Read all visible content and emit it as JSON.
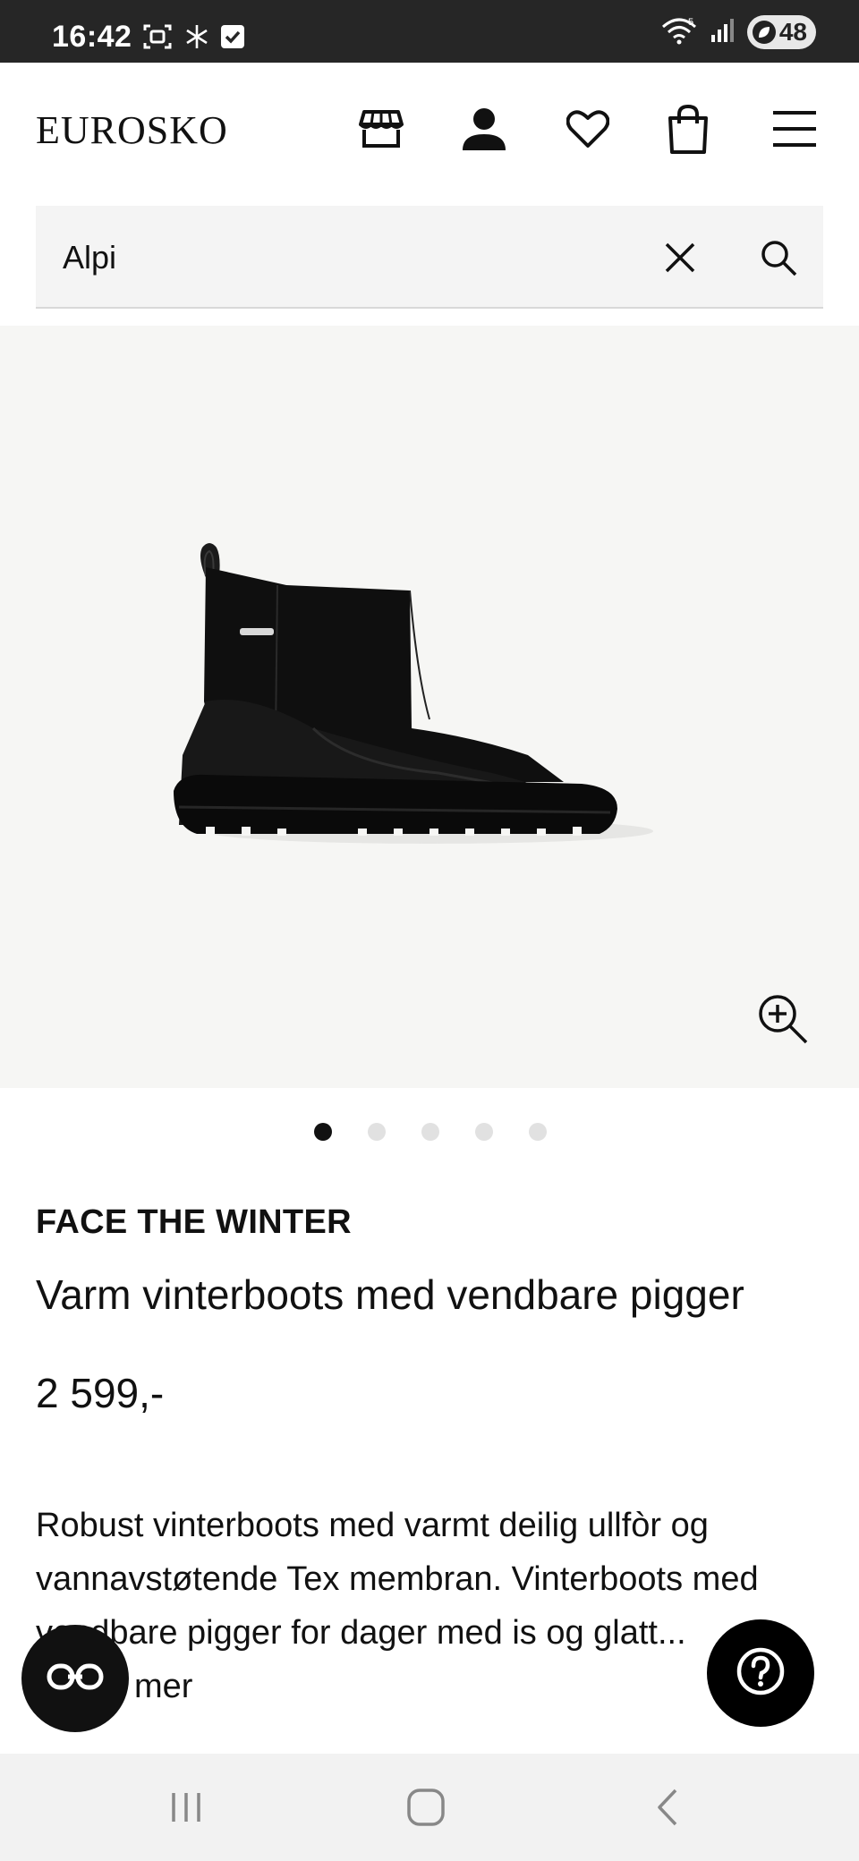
{
  "status_bar": {
    "time": "16:42",
    "icons": [
      "screenshot-icon",
      "snowflake-icon",
      "checkbox-icon"
    ],
    "network": "5",
    "battery": "48"
  },
  "header": {
    "logo": "EUROSKO",
    "icons": [
      "store-icon",
      "account-icon",
      "wishlist-heart-icon",
      "cart-bag-icon",
      "menu-icon"
    ]
  },
  "search": {
    "value": "Alpi",
    "clear_icon": "close-icon",
    "search_icon": "search-icon"
  },
  "gallery": {
    "image": "black winter boot",
    "zoom_icon": "zoom-in-icon",
    "slide_count": 5,
    "active_slide": 1
  },
  "product": {
    "brand": "FACE THE WINTER",
    "title": "Varm vinterboots med vendbare pigger",
    "price": "2 599,-",
    "description": "Robust vinterboots med varmt deilig ullfòr og vannavstøtende Tex membran. Vinterboots med vendbare pigger for dager med is og glatt...",
    "read_more": "mer"
  },
  "floating": {
    "left_icon": "glasses-icon",
    "right_icon": "help-question-icon"
  },
  "nav": {
    "icons": [
      "recent-apps-icon",
      "home-icon",
      "back-icon"
    ]
  },
  "colors": {
    "status_bar": "#262626",
    "gallery_bg": "#f6f6f4",
    "search_bg": "#f4f4f4",
    "dot_active": "#111111",
    "dot_inactive": "#e1e1e1"
  }
}
